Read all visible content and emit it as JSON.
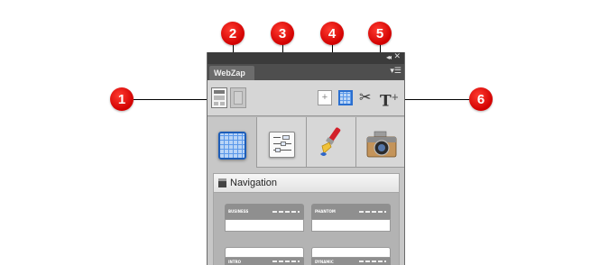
{
  "panel": {
    "collapse_glyph": "◂◂",
    "close_glyph": "✕",
    "tab_label": "WebZap",
    "menu_glyph": "▾☰"
  },
  "toolbar": {
    "add_glyph": "+",
    "scissors_glyph": "✂",
    "text_glyph": "T",
    "text_plus": "+"
  },
  "content": {
    "section_title": "Navigation",
    "thumbnails": [
      {
        "label": "BUSINESS"
      },
      {
        "label": "PHANTOM"
      },
      {
        "label": "INTRO"
      },
      {
        "label": "DYNAMIC"
      }
    ]
  },
  "callouts": [
    "1",
    "2",
    "3",
    "4",
    "5",
    "6"
  ],
  "colors": {
    "callout": "#d10000",
    "panel_bg": "#b9b9b9",
    "accent_blue": "#2a6fd0"
  },
  "icons": [
    "grid-icon",
    "settings-icon",
    "paintbrush-icon",
    "camera-icon",
    "scissors-icon",
    "add-text-icon"
  ]
}
